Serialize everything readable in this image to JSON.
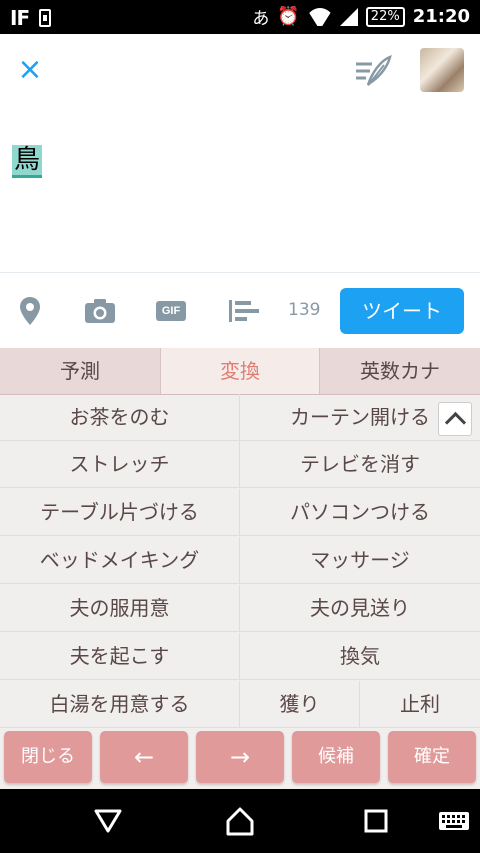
{
  "status_bar": {
    "carrier_logo": "IF",
    "input_indicator": "あ",
    "battery": "22%",
    "time": "21:20",
    "icons": [
      "phone-icon",
      "alarm-icon",
      "wifi-icon",
      "signal-icon",
      "battery-icon"
    ]
  },
  "compose": {
    "close_icon": "×",
    "text": "鳥"
  },
  "toolbar": {
    "gif_label": "GIF",
    "char_count": "139",
    "tweet_label": "ツイート"
  },
  "keyboard": {
    "tabs": [
      "予測",
      "変換",
      "英数カナ"
    ],
    "active_tab": "変換",
    "candidates": [
      [
        "お茶をのむ",
        "カーテン開ける"
      ],
      [
        "ストレッチ",
        "テレビを消す"
      ],
      [
        "テーブル片づける",
        "パソコンつける"
      ],
      [
        "ベッドメイキング",
        "マッサージ"
      ],
      [
        "夫の服用意",
        "夫の見送り"
      ],
      [
        "夫を起こす",
        "換気"
      ]
    ],
    "last_row": [
      "白湯を用意する",
      "獲り",
      "止利"
    ],
    "function_keys": {
      "close": "閉じる",
      "left": "←",
      "right": "→",
      "candidates": "候補",
      "confirm": "確定"
    }
  },
  "colors": {
    "accent": "#1da1f2",
    "keyboard_key": "#e09a9a",
    "active_tab_text": "#e07d72"
  }
}
